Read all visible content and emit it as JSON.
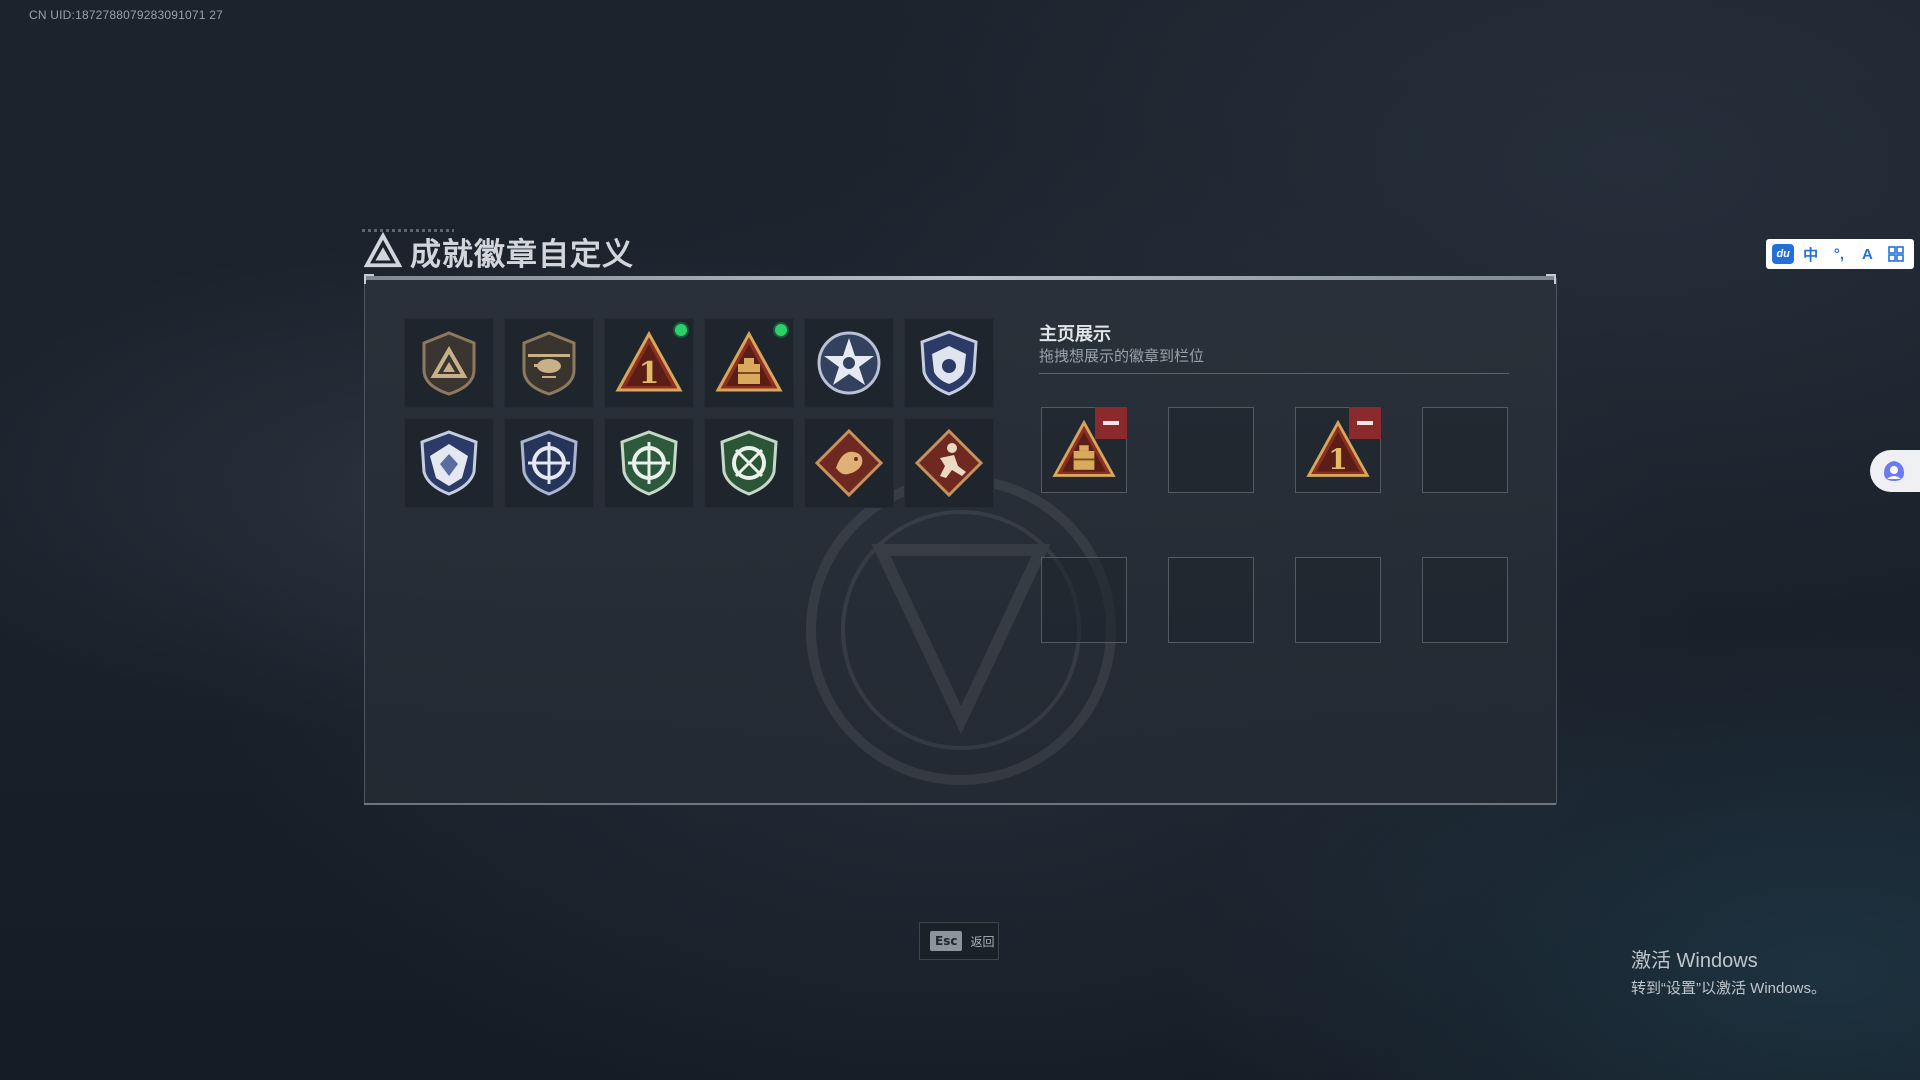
{
  "uid_label": "CN UID:1872788079283091071 27",
  "page": {
    "title": "成就徽章自定义"
  },
  "badges": [
    {
      "icon": "triangle-logo-badge-icon",
      "new": false
    },
    {
      "icon": "helicopter-badge-icon",
      "new": false
    },
    {
      "icon": "rank-one-triangle-badge-icon",
      "new": true
    },
    {
      "icon": "supply-crate-triangle-badge-icon",
      "new": true
    },
    {
      "icon": "star-emblem-badge-icon",
      "new": false
    },
    {
      "icon": "blue-shield-badge-icon",
      "new": false
    },
    {
      "icon": "blue-crest-badge-icon",
      "new": false
    },
    {
      "icon": "crosshair-blue-badge-icon",
      "new": false
    },
    {
      "icon": "crosshair-green-badge-icon",
      "new": false
    },
    {
      "icon": "crosshair-green-2-badge-icon",
      "new": false
    },
    {
      "icon": "dragon-diamond-badge-icon",
      "new": false
    },
    {
      "icon": "runner-diamond-badge-icon",
      "new": false
    }
  ],
  "showcase": {
    "title": "主页展示",
    "subtitle": "拖拽想展示的徽章到栏位",
    "slots": [
      {
        "badge": "supply-crate-triangle-badge-icon"
      },
      {
        "badge": null
      },
      {
        "badge": "rank-one-triangle-badge-icon"
      },
      {
        "badge": null
      },
      {
        "badge": null
      },
      {
        "badge": null
      },
      {
        "badge": null
      },
      {
        "badge": null
      }
    ]
  },
  "footer": {
    "esc_key": "Esc",
    "esc_label": "返回"
  },
  "ime_bar": {
    "items": [
      "du",
      "中",
      "°,",
      "A",
      "grid"
    ]
  },
  "windows_activation": {
    "line1": "激活 Windows",
    "line2": "转到“设置”以激活 Windows。"
  },
  "colors": {
    "accent_new": "#2bd06a",
    "remove": "#8a2a2c"
  }
}
